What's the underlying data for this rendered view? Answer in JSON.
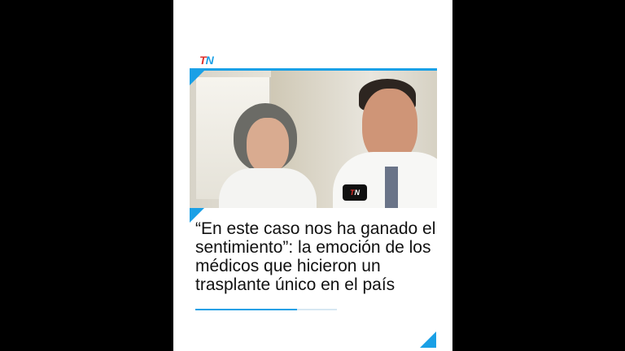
{
  "brand": {
    "logo_t": "T",
    "logo_n": "N",
    "accent_color": "#1aa0e6",
    "logo_red": "#e0312b"
  },
  "video_frame": {
    "mic_logo_t": "T",
    "mic_logo_n": "N"
  },
  "headline": {
    "text": "“En este caso nos ha ganado el sentimiento”: la emoción de los médicos que hicieron un trasplante único en el país"
  },
  "progress": {
    "fraction": 0.72
  }
}
